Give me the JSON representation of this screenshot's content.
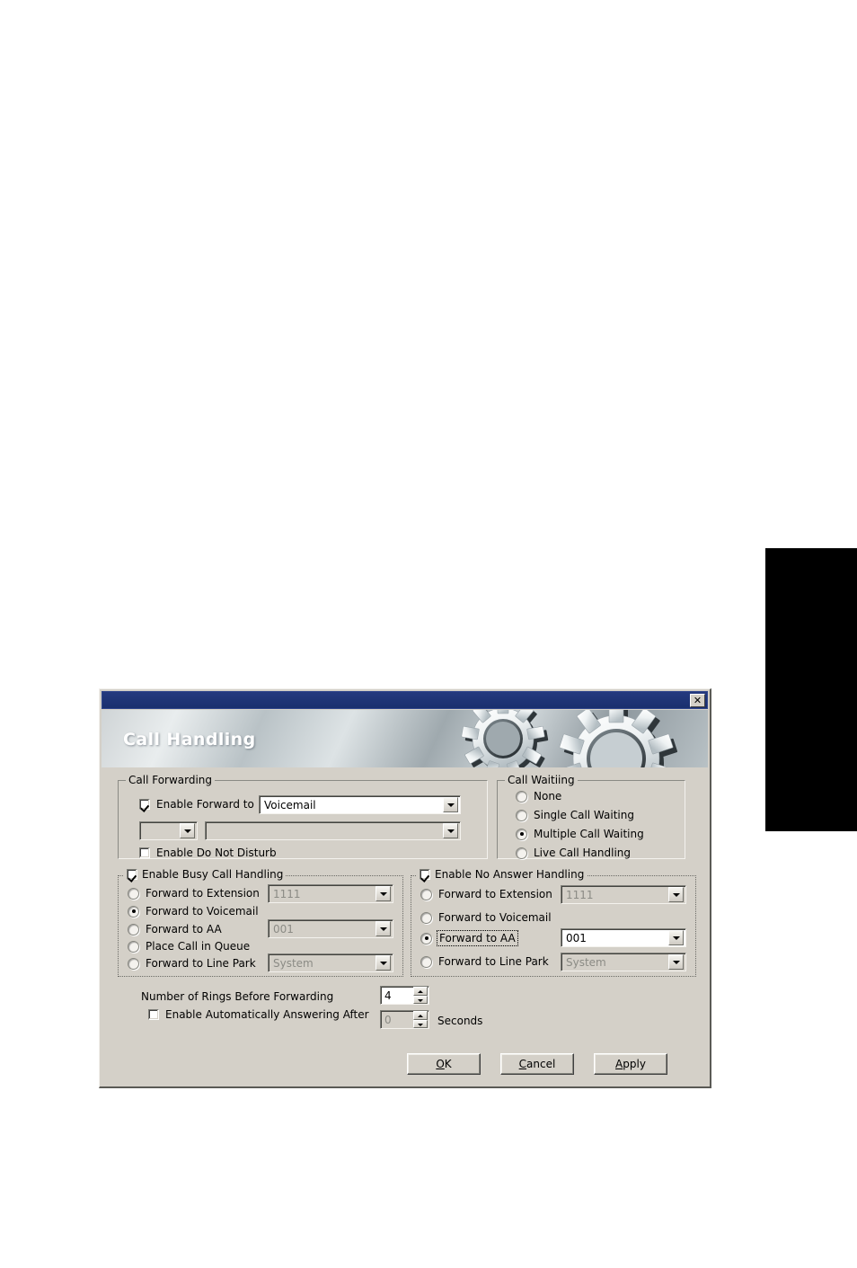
{
  "page": {
    "edge_tab_color": "#000000",
    "background_color": "#ffffff"
  },
  "dialog": {
    "titlebar": {
      "color": "#1f3a7a",
      "close_label": "✕",
      "close_icon": "close-icon"
    },
    "banner": {
      "title": "Call Handling",
      "graphic": "gears-icon"
    },
    "call_forwarding": {
      "legend": "Call Forwarding",
      "enable_forward_to": {
        "label": "Enable Forward to",
        "checked": true
      },
      "target_combo": {
        "value": "Voicemail",
        "enabled": true
      },
      "secondary_small_combo": {
        "value": "",
        "enabled": false
      },
      "secondary_wide_combo": {
        "value": "",
        "enabled": false
      },
      "do_not_disturb": {
        "label": "Enable Do Not Disturb",
        "checked": false
      }
    },
    "call_waiting": {
      "legend": "Call Waitiing",
      "options": [
        {
          "label": "None",
          "selected": false
        },
        {
          "label": "Single Call Waiting",
          "selected": false
        },
        {
          "label": "Multiple Call Waiting",
          "selected": true
        },
        {
          "label": "Live Call Handling",
          "selected": false
        }
      ]
    },
    "busy_call_handling": {
      "legend": "Enable Busy Call Handling",
      "checked": true,
      "options": [
        {
          "label": "Forward to Extension",
          "selected": false,
          "combo": {
            "value": "1111",
            "enabled": false
          }
        },
        {
          "label": "Forward to Voicemail",
          "selected": true,
          "combo": null
        },
        {
          "label": "Forward to AA",
          "selected": false,
          "combo": {
            "value": "001",
            "enabled": false
          }
        },
        {
          "label": "Place Call in Queue",
          "selected": false,
          "combo": null
        },
        {
          "label": "Forward to Line Park",
          "selected": false,
          "combo": {
            "value": "System",
            "enabled": false
          }
        }
      ]
    },
    "no_answer_handling": {
      "legend": "Enable No Answer Handling",
      "checked": true,
      "options": [
        {
          "label": "Forward to Extension",
          "selected": false,
          "focused": false,
          "combo": {
            "value": "1111",
            "enabled": false
          }
        },
        {
          "label": "Forward to Voicemail",
          "selected": false,
          "focused": false,
          "combo": null
        },
        {
          "label": "Forward to AA",
          "selected": true,
          "focused": true,
          "combo": {
            "value": "001",
            "enabled": true
          }
        },
        {
          "label": "Forward to Line Park",
          "selected": false,
          "focused": false,
          "combo": {
            "value": "System",
            "enabled": false
          }
        }
      ]
    },
    "rings": {
      "label": "Number of Rings Before Forwarding",
      "value": "4"
    },
    "auto_answer": {
      "label": "Enable Automatically Answering After",
      "checked": false,
      "value": "0",
      "units": "Seconds"
    },
    "buttons": {
      "ok": {
        "pre": "",
        "accel": "O",
        "post": "K"
      },
      "cancel": {
        "pre": "",
        "accel": "C",
        "post": "ancel"
      },
      "apply": {
        "pre": "",
        "accel": "A",
        "post": "pply"
      }
    }
  }
}
